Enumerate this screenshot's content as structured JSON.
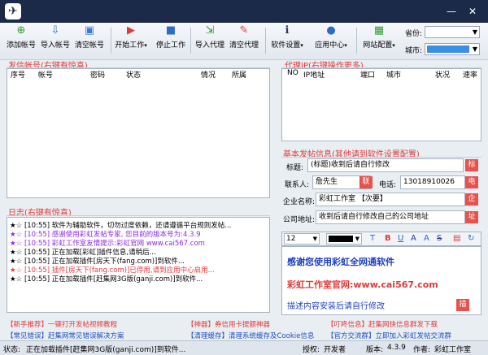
{
  "toolbar": {
    "buttons": [
      {
        "label": "添加帐号",
        "icon": "add-icon"
      },
      {
        "label": "导入帐号",
        "icon": "import-icon"
      },
      {
        "label": "清空帐号",
        "icon": "clear-icon"
      },
      {
        "label": "开始工作",
        "icon": "play-icon"
      },
      {
        "label": "停止工作",
        "icon": "stop-icon"
      },
      {
        "label": "导入代理",
        "icon": "import-proxy-icon"
      },
      {
        "label": "清空代理",
        "icon": "clear-proxy-icon"
      },
      {
        "label": "软件设置",
        "icon": "settings-icon"
      },
      {
        "label": "应用中心",
        "icon": "app-center-icon"
      },
      {
        "label": "网站配置",
        "icon": "site-config-icon"
      }
    ],
    "province_label": "省份:",
    "city_label": "城市:",
    "city_color": "#3a8ee6"
  },
  "accounts": {
    "title": "发信帐号(右键有惊喜)",
    "columns": [
      "序号",
      "帐号",
      "密码",
      "状态",
      "",
      "情况",
      "所属"
    ]
  },
  "proxy": {
    "title": "代理IP(右键操作更多)",
    "columns": [
      "NO",
      "IP地址",
      "端口",
      "城市",
      "状况",
      "速率"
    ]
  },
  "log": {
    "title": "日志(右键有惊喜)",
    "lines": [
      {
        "text": "★☆ [10:55] 软件为辅助软件，切勿过度依赖，还请遵循平台规则发帖...",
        "color": "#000000"
      },
      {
        "text": "★☆ [10:55] 感谢使用彩虹发帖专家, 您目前的版本号为:4.3.9",
        "color": "#8a2be2"
      },
      {
        "text": "★☆ [10:55] 彩虹工作室友情提示:彩虹官网 www.cai567.com",
        "color": "#8a2be2"
      },
      {
        "text": "★☆ [10:55] 正在加载[彩虹]插件信息,请稍后...",
        "color": "#000000"
      },
      {
        "text": "★☆ [10:55] 正在加载插件[房天下(fang.com)]到软件...",
        "color": "#000000"
      },
      {
        "text": "★☆ [10:55] 插件[房天下(fang.com)]已停用,请到应用中心启用...",
        "color": "#e03a3a"
      },
      {
        "text": "★☆ [10:55] 正在加载插件[赶集网3G版(ganji.com)]到软件...",
        "color": "#000000"
      }
    ]
  },
  "post_info": {
    "title": "基本发帖信息(其他请到软件设置配置)",
    "title_label": "标题:",
    "title_value": "(标题)收到后请自行修改",
    "contact_label": "联系人:",
    "contact_value": "詹先生",
    "phone_label": "电话:",
    "phone_value": "13018910026",
    "company_label": "企业名称:",
    "company_value": "彩虹工作室 【次要】",
    "address_label": "公司地址:",
    "address_value": "收到后请自行修改自己的公司地址",
    "tags": [
      "标",
      "联",
      "电",
      "企",
      "址",
      "描"
    ]
  },
  "editor": {
    "font_size": "12",
    "toolbar_buttons": [
      "T",
      "B",
      "U",
      "A",
      "A",
      "S"
    ],
    "line1": "感谢您使用彩虹全网通软件",
    "line2": "彩虹工作室官网:www.cai567.com",
    "line3": "描述内容安装后请自行修改"
  },
  "links": {
    "row1": [
      {
        "text": "【新手推荐】一键打开发帖视频教程",
        "color": "#e03a3a"
      },
      {
        "text": "【神器】券信用卡提额神器",
        "color": "#e03a3a"
      },
      {
        "text": "【叮咚信息】赶集网快信息群发下载",
        "color": "#e03a3a"
      }
    ],
    "row2": [
      {
        "text": "【常见错误】赶集网常见错误解决方案",
        "color": "#1f4fbf"
      },
      {
        "text": "【清理缓存】清理系统缓存及Cookie信息",
        "color": "#1f4fbf"
      },
      {
        "text": "【官方交流群】立即加入彩虹发帖交流群",
        "color": "#1f4fbf"
      }
    ]
  },
  "status": {
    "label": "状态:",
    "text": "正在加载插件[赶集网3G版(ganji.com)]到软件...",
    "auth_label": "授权:",
    "auth_value": "开发者",
    "version_label": "版本:",
    "version_value": "4.3.9",
    "author_label": "作者:",
    "author_value": "彩虹工作室"
  }
}
